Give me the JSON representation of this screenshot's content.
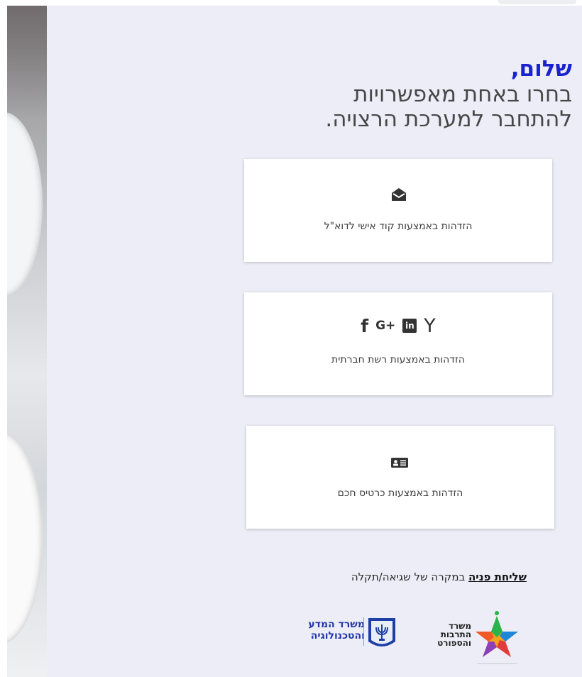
{
  "heading": {
    "greeting": "שלום,",
    "subtitle_line1": "בחרו באחת מאפשרויות",
    "subtitle_line2": "להתחבר למערכת הרצויה."
  },
  "options": [
    {
      "label": "הזדהות באמצעות קוד אישי לדוא\"ל",
      "icon": "envelope-open-icon"
    },
    {
      "label": "הזדהות באמצעות רשת חברתית",
      "icons": [
        "facebook-icon",
        "google-plus-icon",
        "linkedin-icon",
        "yahoo-icon"
      ],
      "icon_glyphs": {
        "facebook": "f",
        "google_plus": "G+",
        "linkedin": "in",
        "yahoo": "Y"
      }
    },
    {
      "label": "הזדהות באמצעות כרטיס חכם",
      "icon": "id-card-icon"
    }
  ],
  "support": {
    "link_text": "שליחת פניה",
    "rest_text": " במקרה של שגיאה/תקלה"
  },
  "logos": {
    "science_ministry": {
      "line1": "משרד המדע",
      "line2": "והטכנולוגיה"
    },
    "culture_ministry": {
      "line1": "משרד",
      "line2": "התרבות",
      "line3": "והספורט"
    }
  },
  "colors": {
    "accent": "#1a21d0",
    "panel_background": "#ecedf7",
    "card_background": "#ffffff",
    "text": "#474747"
  }
}
